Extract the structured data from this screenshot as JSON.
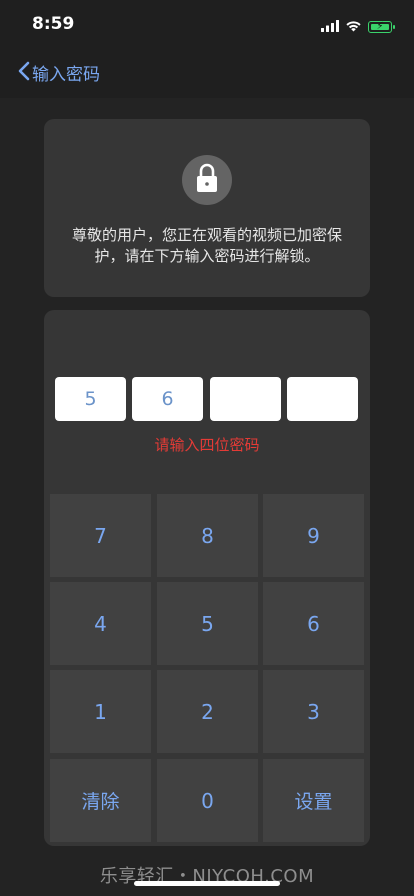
{
  "status": {
    "time": "8:59"
  },
  "nav": {
    "title": "输入密码"
  },
  "info": {
    "message": "尊敬的用户，您正在观看的视频已加密保护，请在下方输入密码进行解锁。"
  },
  "pin": {
    "digits": [
      "5",
      "6",
      "",
      ""
    ],
    "hint": "请输入四位密码"
  },
  "keypad": {
    "rows": [
      [
        "7",
        "8",
        "9"
      ],
      [
        "4",
        "5",
        "6"
      ],
      [
        "1",
        "2",
        "3"
      ],
      [
        "清除",
        "0",
        "设置"
      ]
    ]
  },
  "watermark": "乐享轻汇・NJYCQH.COM",
  "colors": {
    "accent": "#7aa7f0",
    "error": "#e43b36",
    "battery": "#3ad36b"
  }
}
